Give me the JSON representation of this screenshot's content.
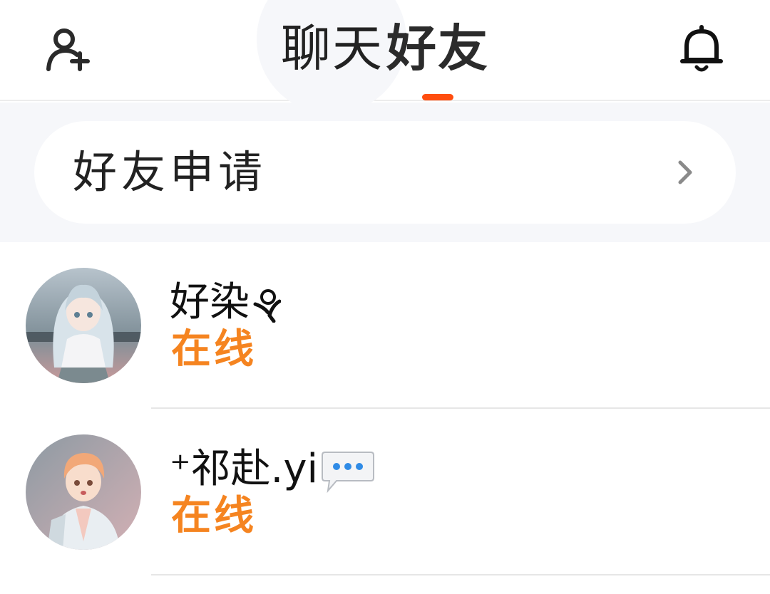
{
  "header": {
    "tabs": [
      {
        "label": "聊天",
        "active": false
      },
      {
        "label": "好友",
        "active": true
      }
    ],
    "left_icon": "add-user-icon",
    "right_icon": "bell-icon"
  },
  "friend_requests": {
    "label": "好友申请",
    "icon": "chevron-right-icon"
  },
  "friends": [
    {
      "name": "好染",
      "status": "在线",
      "name_icon": "flower-sprout-icon"
    },
    {
      "name": "⁺祁赴.yi",
      "status": "在线",
      "name_icon": "speech-bubble-icon"
    }
  ],
  "colors": {
    "accent": "#ff4d0f",
    "online": "#f58420",
    "background": "#f6f7fa"
  }
}
